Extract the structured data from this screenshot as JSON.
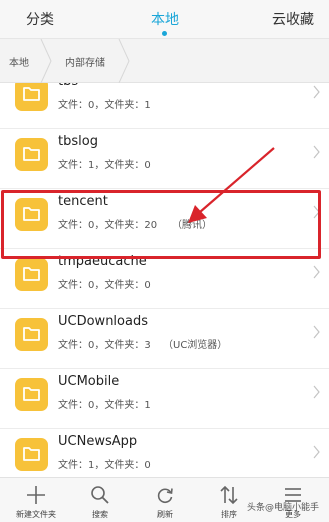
{
  "tabs": {
    "category": "分类",
    "local": "本地",
    "cloud": "云收藏"
  },
  "breadcrumb": {
    "root": "本地",
    "storage": "内部存储"
  },
  "files": [
    {
      "name": "tbs",
      "meta": "文件：0，文件夹：1",
      "note": ""
    },
    {
      "name": "tbslog",
      "meta": "文件：1，文件夹：0",
      "note": ""
    },
    {
      "name": "tencent",
      "meta": "文件：0，文件夹：20",
      "note": "（腾讯）"
    },
    {
      "name": "tmpaeucache",
      "meta": "文件：0，文件夹：0",
      "note": ""
    },
    {
      "name": "UCDownloads",
      "meta": "文件：0，文件夹：3",
      "note": "（UC浏览器）"
    },
    {
      "name": "UCMobile",
      "meta": "文件：0，文件夹：1",
      "note": ""
    },
    {
      "name": "UCNewsApp",
      "meta": "文件：1，文件夹：0",
      "note": ""
    }
  ],
  "bottom": {
    "new_folder": "新建文件夹",
    "search": "搜索",
    "refresh": "刷新",
    "sort": "排序",
    "more": "更多"
  },
  "watermark": "头条@电脑小能手",
  "colors": {
    "accent": "#1aa6d8",
    "folder": "#f7c23a",
    "highlight": "#d9242b"
  }
}
